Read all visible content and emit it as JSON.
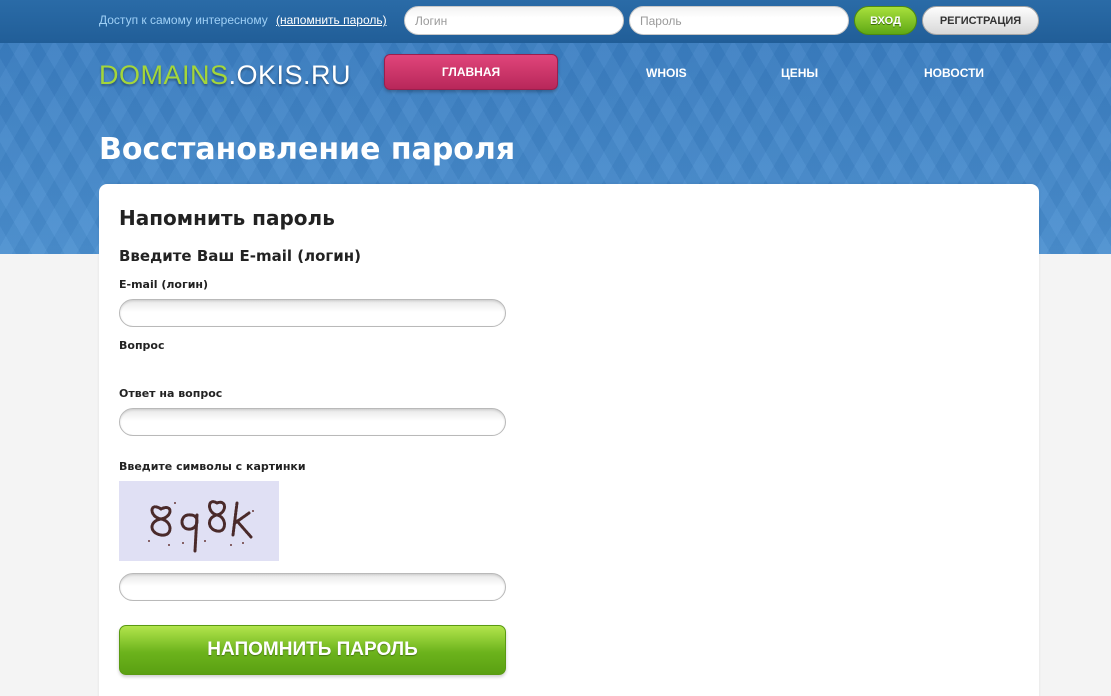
{
  "topbar": {
    "access_text": "Доступ к самому интересному",
    "remind_link": "(напомнить пароль)",
    "login_placeholder": "Логин",
    "password_placeholder": "Пароль",
    "enter_label": "ВХОД",
    "register_label": "РЕГИСТРАЦИЯ"
  },
  "header": {
    "logo_part1": "DOMAINS",
    "logo_part2": ".OKIS.RU",
    "nav": {
      "main": "ГЛАВНАЯ",
      "whois": "WHOIS",
      "prices": "ЦЕНЫ",
      "news": "НОВОСТИ"
    },
    "page_title": "Восстановление пароля"
  },
  "form": {
    "title": "Напомнить пароль",
    "subtitle": "Введите Ваш E-mail (логин)",
    "email_label": "E-mail (логин)",
    "question_label": "Вопрос",
    "answer_label": "Ответ на вопрос",
    "captcha_label": "Введите символы с картинки",
    "captcha_text": "8q8k",
    "submit_label": "НАПОМНИТЬ ПАРОЛЬ"
  },
  "colors": {
    "topbar_bg": "#215e98",
    "header_bg": "#3e85c8",
    "logo_green": "#a4d63a",
    "nav_active": "#c93366",
    "button_green": "#6cb31c",
    "captcha_bg": "#e0e0f4"
  }
}
